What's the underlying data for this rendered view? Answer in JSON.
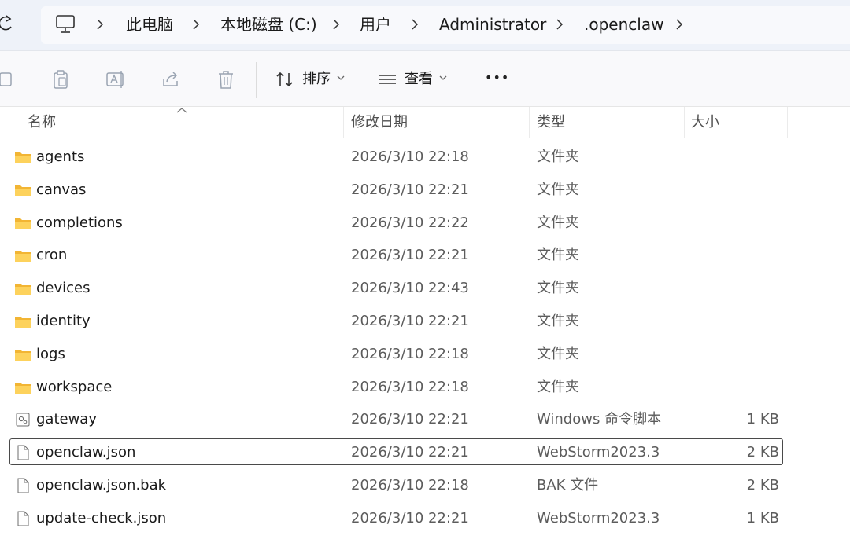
{
  "breadcrumb": [
    "此电脑",
    "本地磁盘 (C:)",
    "用户",
    "Administrator",
    ".openclaw"
  ],
  "toolbar": {
    "sort_label": "排序",
    "view_label": "查看",
    "more_label": "•••"
  },
  "columns": {
    "name": "名称",
    "modified": "修改日期",
    "type": "类型",
    "size": "大小"
  },
  "files": [
    {
      "icon": "folder-icon",
      "name": "agents",
      "modified": "2026/3/10 22:18",
      "type": "文件夹",
      "size": ""
    },
    {
      "icon": "folder-icon",
      "name": "canvas",
      "modified": "2026/3/10 22:21",
      "type": "文件夹",
      "size": ""
    },
    {
      "icon": "folder-icon",
      "name": "completions",
      "modified": "2026/3/10 22:22",
      "type": "文件夹",
      "size": ""
    },
    {
      "icon": "folder-icon",
      "name": "cron",
      "modified": "2026/3/10 22:21",
      "type": "文件夹",
      "size": ""
    },
    {
      "icon": "folder-icon",
      "name": "devices",
      "modified": "2026/3/10 22:43",
      "type": "文件夹",
      "size": ""
    },
    {
      "icon": "folder-icon",
      "name": "identity",
      "modified": "2026/3/10 22:21",
      "type": "文件夹",
      "size": ""
    },
    {
      "icon": "folder-icon",
      "name": "logs",
      "modified": "2026/3/10 22:18",
      "type": "文件夹",
      "size": ""
    },
    {
      "icon": "folder-icon",
      "name": "workspace",
      "modified": "2026/3/10 22:18",
      "type": "文件夹",
      "size": ""
    },
    {
      "icon": "script-file-icon",
      "name": "gateway",
      "modified": "2026/3/10 22:21",
      "type": "Windows 命令脚本",
      "size": "1 KB"
    },
    {
      "icon": "file-icon",
      "name": "openclaw.json",
      "modified": "2026/3/10 22:21",
      "type": "WebStorm2023.3",
      "size": "2 KB"
    },
    {
      "icon": "file-icon",
      "name": "openclaw.json.bak",
      "modified": "2026/3/10 22:18",
      "type": "BAK 文件",
      "size": "2 KB"
    },
    {
      "icon": "file-icon",
      "name": "update-check.json",
      "modified": "2026/3/10 22:21",
      "type": "WebStorm2023.3",
      "size": "1 KB"
    }
  ],
  "focused_file": "openclaw.json",
  "colors": {
    "folder": "#f8c74a",
    "address_bg": "#eef2f9",
    "focus_border": "#4a4a4a"
  }
}
